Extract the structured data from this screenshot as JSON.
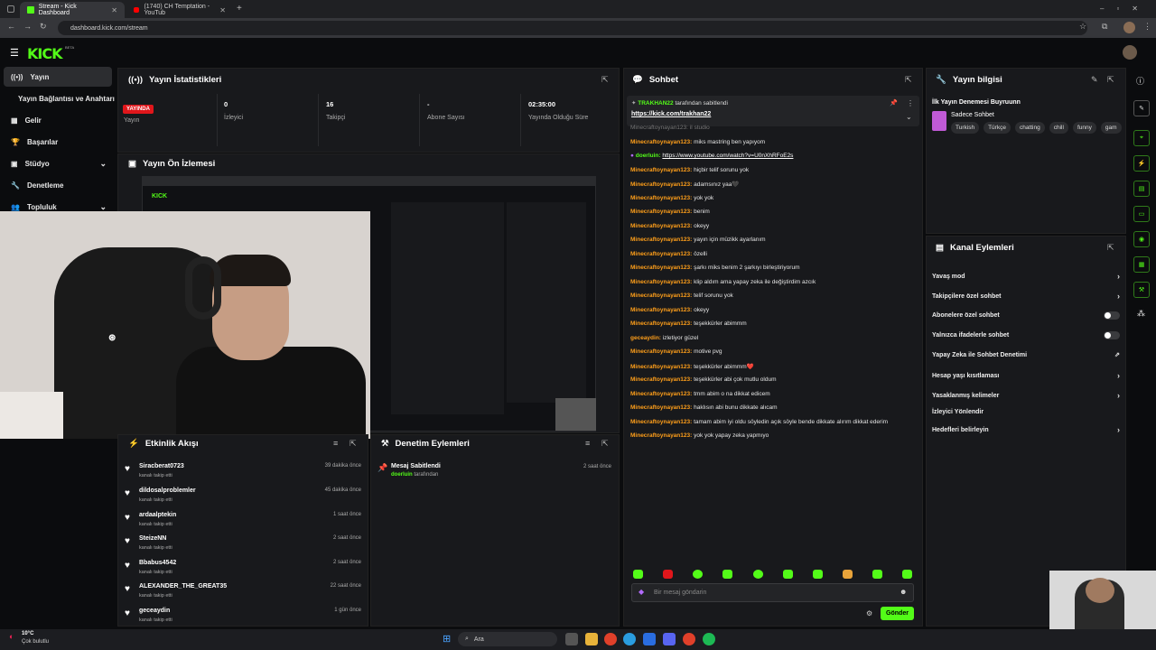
{
  "browser": {
    "tabs": [
      {
        "title": "Stream - Kick Dashboard"
      },
      {
        "title": "(1740) CH Temptation - YouTub"
      }
    ],
    "url": "dashboard.kick.com/stream"
  },
  "app": {
    "logo": "KICK",
    "beta": "BETA"
  },
  "sidebar": {
    "items": [
      {
        "label": "Yayın"
      },
      {
        "label": "Yayın Bağlantısı ve Anahtarı"
      },
      {
        "label": "Gelir"
      },
      {
        "label": "Başarılar"
      },
      {
        "label": "Stüdyo"
      },
      {
        "label": "Denetleme"
      },
      {
        "label": "Topluluk"
      }
    ]
  },
  "stats": {
    "title": "Yayın İstatistikleri",
    "live_badge": "YAYINDA",
    "live_label": "Yayın",
    "viewers_value": "0",
    "viewers_label": "İzleyici",
    "followers_value": "16",
    "followers_label": "Takipçi",
    "subs_value": "-",
    "subs_label": "Abone Sayısı",
    "duration_value": "02:35:00",
    "duration_label": "Yayında Olduğu Süre"
  },
  "preview": {
    "title": "Yayın Ön İzlemesi"
  },
  "activity": {
    "title": "Etkinlik Akışı",
    "items": [
      {
        "name": "Siracberat0723",
        "sub": "kanalı takip etti",
        "time": "39 dakika önce"
      },
      {
        "name": "dildosalproblemler",
        "sub": "kanalı takip etti",
        "time": "45 dakika önce"
      },
      {
        "name": "ardaalptekin",
        "sub": "kanalı takip etti",
        "time": "1 saat önce"
      },
      {
        "name": "SteizeNN",
        "sub": "kanalı takip etti",
        "time": "2 saat önce"
      },
      {
        "name": "Bbabus4542",
        "sub": "kanalı takip etti",
        "time": "2 saat önce"
      },
      {
        "name": "ALEXANDER_THE_GREAT35",
        "sub": "kanalı takip etti",
        "time": "22 saat önce"
      },
      {
        "name": "geceaydin",
        "sub": "kanalı takip etti",
        "time": "1 gün önce"
      }
    ]
  },
  "moderation": {
    "title": "Denetim Eylemleri",
    "action": "Mesaj Sabitlendi",
    "by_user": "doerluin",
    "by_suffix": "tarafından",
    "time": "2 saat önce"
  },
  "chat": {
    "title": "Sohbet",
    "pinned_by": "TRAKHAN22",
    "pinned_suffix": "tarafından sabitlendi",
    "pinned_link": "https://kick.com/trakhan22",
    "messages": [
      {
        "user": "Minecraftoynayan123:",
        "text": "miks mastring ben yapıyom"
      },
      {
        "user": "doerluin:",
        "text": "https://www.youtube.com/watch?v=U0nXhRFoE2s",
        "alt": true
      },
      {
        "user": "Minecraftoynayan123:",
        "text": "hiçbir telif sorunu yok"
      },
      {
        "user": "Minecraftoynayan123:",
        "text": "adamsınız yaa🖤"
      },
      {
        "user": "Minecraftoynayan123:",
        "text": "yok yok"
      },
      {
        "user": "Minecraftoynayan123:",
        "text": "benim"
      },
      {
        "user": "Minecraftoynayan123:",
        "text": "okeyy"
      },
      {
        "user": "Minecraftoynayan123:",
        "text": "yayın için müzikk ayarlanım"
      },
      {
        "user": "Minecraftoynayan123:",
        "text": "özelli"
      },
      {
        "user": "Minecraftoynayan123:",
        "text": "şarkı miks benim 2 şarkıyı birleştiriyorum"
      },
      {
        "user": "Minecraftoynayan123:",
        "text": "klip aldım ama yapay zeka ile değiştirdim azcık"
      },
      {
        "user": "Minecraftoynayan123:",
        "text": "telif sorunu yok"
      },
      {
        "user": "Minecraftoynayan123:",
        "text": "okeyy"
      },
      {
        "user": "Minecraftoynayan123:",
        "text": "teşekkürler abimmm"
      },
      {
        "user": "geceaydin:",
        "text": "izletiyor güzel"
      },
      {
        "user": "Minecraftoynayan123:",
        "text": "motive pvg"
      },
      {
        "user": "Minecraftoynayan123:",
        "text": "teşekkürler abimmm❤️"
      },
      {
        "user": "Minecraftoynayan123:",
        "text": "teşekkürler abi çok mutlu oldum"
      },
      {
        "user": "Minecraftoynayan123:",
        "text": "tmm abim o na dikkat edicem"
      },
      {
        "user": "Minecraftoynayan123:",
        "text": "haklısın abi bunu dikkate alıcam"
      },
      {
        "user": "Minecraftoynayan123:",
        "text": "tamam abim iyi oldu söyledin açık söyle bende dikkate alırım dikkat ederim"
      },
      {
        "user": "Minecraftoynayan123:",
        "text": "yok yok yapay zeka yapmıyo"
      }
    ],
    "input_placeholder": "Bir mesaj göndarin",
    "send_label": "Gönder"
  },
  "info": {
    "title": "Yayın bilgisi",
    "stream_title": "İlk Yayın Denemesi Buyruunn",
    "category": "Sadece Sohbet",
    "tags": [
      "Turkish",
      "Türkçe",
      "chatting",
      "chill",
      "funny",
      "gam"
    ]
  },
  "channel_actions": {
    "title": "Kanal Eylemleri",
    "items": [
      {
        "label": "Yavaş mod",
        "control": "chevron"
      },
      {
        "label": "Takipçilere özel sohbet",
        "control": "chevron"
      },
      {
        "label": "Abonelere özel sohbet",
        "control": "toggle"
      },
      {
        "label": "Yalnızca ifadelerle sohbet",
        "control": "toggle"
      },
      {
        "label": "Yapay Zeka ile Sohbet Denetimi",
        "control": "external"
      },
      {
        "label": "Hesap yaşı kısıtlaması",
        "control": "chevron"
      },
      {
        "label": "Yasaklanmış kelimeler",
        "control": "chevron"
      },
      {
        "label": "İzleyici Yönlendir",
        "control": "none"
      },
      {
        "label": "Hedefleri belirleyin",
        "control": "chevron"
      }
    ]
  },
  "taskbar": {
    "weather_temp": "10°C",
    "weather_desc": "Çok bulutlu",
    "search_placeholder": "Ara"
  }
}
